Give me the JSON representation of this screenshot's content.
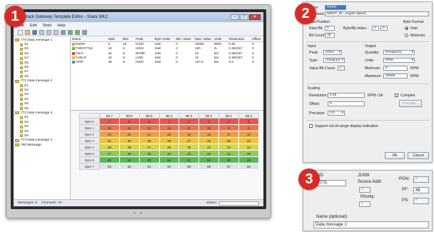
{
  "badges": [
    "1",
    "2",
    "3"
  ],
  "app": {
    "title": "Stack Gateway Template Editor - Stack MK2",
    "window_buttons": [
      "–",
      "□",
      "✕"
    ],
    "menu": [
      "File",
      "Edit",
      "Tools",
      "Help"
    ],
    "toolbar_icons": [
      "new-icon",
      "open-icon",
      "save-icon",
      "cut-icon",
      "copy-icon",
      "paste-icon",
      "find-icon",
      "undo-icon",
      "redo-icon",
      "settings-icon"
    ],
    "tree": [
      {
        "label": "770 Data message 1",
        "type": "folder"
      },
      {
        "label": "S1",
        "type": "leaf"
      },
      {
        "label": "S2",
        "type": "leaf"
      },
      {
        "label": "S3",
        "type": "leaf"
      },
      {
        "label": "S4",
        "type": "leaf"
      },
      {
        "label": "S5",
        "type": "leaf"
      },
      {
        "label": "S6",
        "type": "leaf"
      },
      {
        "label": "S7",
        "type": "leaf"
      },
      {
        "label": "S8",
        "type": "leaf"
      },
      {
        "label": "771 Data message 2",
        "type": "folder"
      },
      {
        "label": "S1",
        "type": "leaf"
      },
      {
        "label": "S2",
        "type": "leaf"
      },
      {
        "label": "S3",
        "type": "leaf"
      },
      {
        "label": "S4",
        "type": "leaf"
      },
      {
        "label": "S5",
        "type": "leaf"
      },
      {
        "label": "S6",
        "type": "leaf"
      },
      {
        "label": "772 Data message 3",
        "type": "folder"
      },
      {
        "label": "S1",
        "type": "leaf"
      },
      {
        "label": "S2",
        "type": "leaf"
      },
      {
        "label": "S3",
        "type": "leaf"
      },
      {
        "label": "S4",
        "type": "leaf"
      },
      {
        "label": "S5",
        "type": "leaf"
      },
      {
        "label": "773 Data message 4",
        "type": "folder"
      },
      {
        "label": "780 Message",
        "type": "folder"
      }
    ],
    "signal_table": {
      "headers": [
        "Name",
        "Start",
        "Bits",
        "Peak",
        "Byte Order",
        "Min. Value",
        "Max. Value",
        "Units",
        "Resolution",
        "Offset"
      ],
      "rows": [
        {
          "color": "#e2a23a",
          "cells": [
            "RSPD",
            "0",
            "16",
            "HIGH",
            "Intel",
            "0",
            "10000",
            "RPM",
            "0.25",
            "0"
          ]
        },
        {
          "color": "#6cb04a",
          "cells": [
            "THROTTLE",
            "24",
            "8",
            "HIGH",
            "Intel",
            "0",
            "100",
            "%",
            "0.392157",
            "0"
          ]
        },
        {
          "color": "#d9453c",
          "cells": [
            "OILP",
            "32",
            "8",
            "NONE",
            "Intel",
            "0",
            "10",
            "bar",
            "0.392157",
            "0"
          ]
        },
        {
          "color": "#d8c23a",
          "cells": [
            "FUELP",
            "40",
            "8",
            "LOW",
            "Intel",
            "0",
            "10",
            "bar",
            "0.392157",
            "0"
          ]
        },
        {
          "color": "#4f86c9",
          "cells": [
            "AIRP",
            "48",
            "8",
            "HIGH",
            "Intel",
            "0",
            "127.5",
            "bar",
            "0.5",
            "0"
          ]
        }
      ]
    },
    "byte_grid": {
      "col_headers": [
        "",
        "Bit 7",
        "Bit 6",
        "Bit 5",
        "Bit 4",
        "Bit 3",
        "Bit 2",
        "Bit 1",
        "Bit 0"
      ],
      "rows": [
        {
          "label": "Byte 0",
          "cells": [
            "7",
            "6",
            "5",
            "4",
            "3",
            "2",
            "1",
            "0"
          ]
        },
        {
          "label": "Byte 1",
          "cells": [
            "15",
            "14",
            "13",
            "12",
            "11",
            "10",
            "9",
            "8"
          ]
        },
        {
          "label": "Byte 2",
          "cells": [
            "23",
            "22",
            "21",
            "20",
            "19",
            "18",
            "17",
            "16"
          ]
        },
        {
          "label": "Byte 3",
          "cells": [
            "31",
            "30",
            "29",
            "28",
            "27",
            "26",
            "25",
            "24"
          ]
        },
        {
          "label": "Byte 4",
          "cells": [
            "39",
            "38",
            "37",
            "36",
            "35",
            "34",
            "33",
            "32"
          ]
        },
        {
          "label": "Byte 5",
          "cells": [
            "47",
            "46",
            "45",
            "44",
            "43",
            "42",
            "41",
            "40"
          ]
        },
        {
          "label": "Byte 6",
          "cells": [
            "55",
            "54",
            "53",
            "52",
            "51",
            "50",
            "49",
            "48"
          ]
        },
        {
          "label": "Byte 7",
          "cells": [
            "63",
            "62",
            "61",
            "60",
            "59",
            "58",
            "57",
            "56"
          ]
        }
      ],
      "row_colors": [
        "#e8574b",
        "#e8784b",
        "#e6a248",
        "#e9c24a",
        "#d7d64d",
        "#8ecb57",
        "#58b95a",
        "#dfe2e6"
      ]
    },
    "status": {
      "messages": "Messages: 5",
      "channels": "Channels: 46",
      "status_label": "Status:"
    }
  },
  "dialog2": {
    "name_label": "Name:",
    "name_value": "RSPD",
    "comment_label": "Comment:",
    "comment_value": "NMOT_W - engine speed",
    "data_position_label": "Data Position",
    "start_bit_label": "Start Bit:",
    "start_bit_value": "0",
    "byte_bit_index_label": "Byte/Bit index:",
    "byte_index_value": "1",
    "bit_index_value": "0",
    "bit_count_label": "Bit Count:",
    "bit_count_value": "16",
    "byte_format_label": "Byte Format",
    "byte_format_intel": "Intel",
    "byte_format_motorola": "Motorola",
    "input_label": "Input",
    "peak_label": "Peak:",
    "peak_value": "HIGH",
    "type_label": "Type:",
    "type_value": "Unsigned",
    "value_bit_count_label": "Value Bit Count:",
    "value_bit_count_value": "0",
    "output_label": "Output",
    "quantity_label": "Quantity:",
    "quantity_value": "Frequency",
    "units_label": "Units:",
    "units_value": "RPM",
    "minimum_label": "Minimum:",
    "minimum_value": "0",
    "minimum_unit": "RPM",
    "maximum_label": "Maximum:",
    "maximum_value": "10000",
    "maximum_unit": "RPM",
    "scaling_label": "Scaling",
    "resolution_label": "Resolution:",
    "resolution_value": "0.25",
    "resolution_unit": "RPM / bit",
    "complex_label": "Complex",
    "formula_label": "Formula...",
    "offset_label": "Offset:",
    "offset_value": "0",
    "precision_label": "Precision:",
    "precision_value": "0.2",
    "out_of_range_label": "Support out-of-range display indication",
    "ok_label": "OK",
    "cancel_label": "Cancel"
  },
  "dialog3": {
    "id_label": "ID",
    "id_value": "770",
    "j1939_label": "J1939",
    "source_addr_label": "Source Addr:",
    "source_addr_value": "0",
    "priority_label": "Priority:",
    "priority_value": "0",
    "pgn_label": "PGN:",
    "pgn_value": "0",
    "pf_label": "PF:",
    "pf_value": "48",
    "ps_label": "PS:",
    "ps_value": "0",
    "name_optional_label": "Name (optional):",
    "name_optional_value": "Data message 1"
  }
}
